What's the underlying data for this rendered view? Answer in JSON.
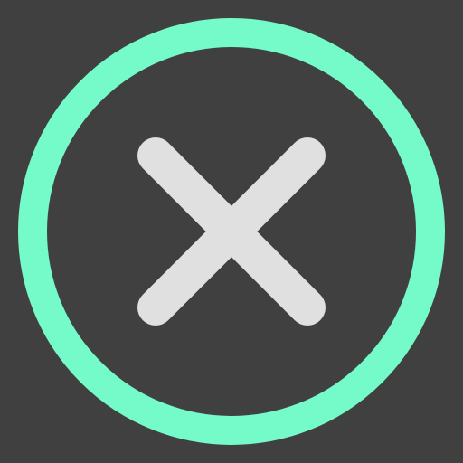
{
  "icon": {
    "name": "close-circle-icon",
    "colors": {
      "background": "#404040",
      "ring": "#75FBC9",
      "cross": "#E0E0E0"
    }
  }
}
